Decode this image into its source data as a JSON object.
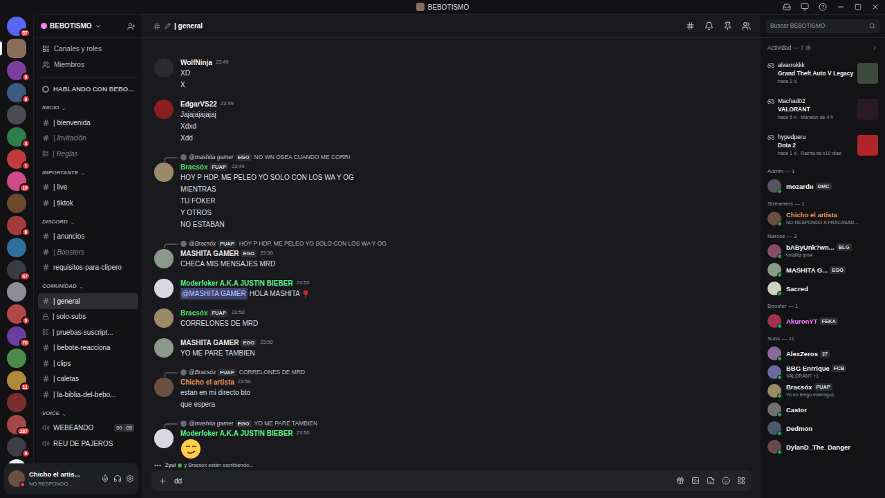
{
  "window": {
    "title": "BEBOTISMO"
  },
  "servers": [
    {
      "badge": "57",
      "color": "#5865f2",
      "selected": false
    },
    {
      "badge": "",
      "color": "#8a6d5a",
      "selected": true
    },
    {
      "badge": "9",
      "color": "#7b3fa0",
      "selected": false
    },
    {
      "badge": "8",
      "color": "#3d5a80",
      "selected": false
    },
    {
      "badge": "",
      "color": "#4a4a55",
      "selected": false
    },
    {
      "badge": "3",
      "color": "#2f7d4a",
      "selected": false
    },
    {
      "badge": "1",
      "color": "#c23b3b",
      "selected": false
    },
    {
      "badge": "10",
      "color": "#d04a8a",
      "selected": false
    },
    {
      "badge": "",
      "color": "#6b4a2e",
      "selected": false
    },
    {
      "badge": "6",
      "color": "#a33a3a",
      "selected": false
    },
    {
      "badge": "",
      "color": "#2e6f9e",
      "selected": false
    },
    {
      "badge": "47",
      "color": "#3a3a44",
      "selected": false
    },
    {
      "badge": "",
      "color": "#8d8d99",
      "selected": false
    },
    {
      "badge": "9",
      "color": "#b04747",
      "selected": false
    },
    {
      "badge": "70",
      "color": "#6a3fa0",
      "selected": false
    },
    {
      "badge": "",
      "color": "#4b8a4b",
      "selected": false
    },
    {
      "badge": "11",
      "color": "#b08a3a",
      "selected": false
    },
    {
      "badge": "",
      "color": "#7a2e2e",
      "selected": false
    },
    {
      "badge": "287",
      "color": "#a34848",
      "selected": false
    },
    {
      "badge": "9",
      "color": "#3e3e48",
      "selected": false
    },
    {
      "badge": "",
      "color": "#f2f3f5",
      "selected": false
    }
  ],
  "guild": {
    "name": "BEBOTISMO"
  },
  "sidebar": {
    "top_items": [
      {
        "label": "Canales y roles",
        "kind": "channels"
      },
      {
        "label": "Miembros",
        "kind": "members"
      }
    ],
    "event": "HABLANDO CON BEBO...",
    "categories": [
      {
        "name": "INICIO",
        "channels": [
          {
            "name": "| bienvenida",
            "kind": "text",
            "selected": false,
            "muted": false
          },
          {
            "name": "| Invitación",
            "kind": "text",
            "selected": false,
            "muted": true
          },
          {
            "name": "| Reglas",
            "kind": "rules",
            "selected": false,
            "muted": true
          }
        ]
      },
      {
        "name": "IMPORTANTE",
        "channels": [
          {
            "name": "| live",
            "kind": "text",
            "selected": false,
            "muted": false
          },
          {
            "name": "| tiktok",
            "kind": "text",
            "selected": false,
            "muted": false
          }
        ]
      },
      {
        "name": "DISCORD",
        "channels": [
          {
            "name": "| anuncios",
            "kind": "text",
            "selected": false,
            "muted": false
          },
          {
            "name": "| Boosters",
            "kind": "text",
            "selected": false,
            "muted": true
          },
          {
            "name": "requisitos-para-clipero",
            "kind": "text",
            "selected": false,
            "muted": false
          }
        ]
      },
      {
        "name": "COMUNIDAD",
        "channels": [
          {
            "name": "| general",
            "kind": "text",
            "selected": true,
            "muted": false
          },
          {
            "name": "| solo-subs",
            "kind": "locked",
            "selected": false,
            "muted": false
          },
          {
            "name": "| pruebas-suscript...",
            "kind": "rules",
            "selected": false,
            "muted": false
          },
          {
            "name": "| bebote-reacciona",
            "kind": "text",
            "selected": false,
            "muted": false
          },
          {
            "name": "| clips",
            "kind": "text",
            "selected": false,
            "muted": false
          },
          {
            "name": "| caletas",
            "kind": "text",
            "selected": false,
            "muted": false
          },
          {
            "name": "| la-biblia-del-bebo...",
            "kind": "text",
            "selected": false,
            "muted": false
          }
        ]
      },
      {
        "name": "VOICE",
        "channels": [
          {
            "name": "WEBEANDO",
            "kind": "voice",
            "selected": false,
            "muted": false,
            "counts": [
              "00",
              "05"
            ]
          },
          {
            "name": "REU DE PAJEROS",
            "kind": "voice",
            "selected": false,
            "muted": false,
            "counts": []
          }
        ]
      }
    ]
  },
  "user_panel": {
    "name": "Chicho el artis...",
    "status": "NO RESPONDO..."
  },
  "chat": {
    "channel": "| general"
  },
  "messages": [
    {
      "author": "WolfNinja",
      "color": "#f2f3f5",
      "avatar": "#2b2b30",
      "tag": "",
      "time": "23:49",
      "kind": "text",
      "reply": null,
      "mention": "",
      "lines": [
        "XD",
        "X"
      ]
    },
    {
      "author": "EdgarVS22",
      "color": "#f2f3f5",
      "avatar": "#8a1f1f",
      "tag": "",
      "time": "23:49",
      "kind": "text",
      "reply": null,
      "mention": "",
      "lines": [
        "Jajajajajajaj",
        "Xdxd",
        "Xdd"
      ]
    },
    {
      "author": "Bracsóx",
      "color": "#5bd46a",
      "avatar": "#9a8a6a",
      "tag": "FUAP",
      "time": "23:49",
      "kind": "text",
      "reply": {
        "author": "@mashita gamer",
        "tag": "EGO",
        "text": "NO WN OSEA CUANDO ME CORRI"
      },
      "mention": "",
      "lines": [
        "HOY P HDP. ME PELEO YO SOLO CON LOS WA Y OG",
        "MIENTRAS",
        "TU FOKER",
        "Y OTROS",
        "NO ESTABAN"
      ]
    },
    {
      "author": "MASHITA GAMER",
      "color": "#e6e6e6",
      "avatar": "#8a9a8a",
      "tag": "EGO",
      "time": "23:50",
      "kind": "text",
      "reply": {
        "author": "@Bracsóx",
        "tag": "FUAP",
        "text": "HOY P HDP. ME PELEO YO SOLO CON LOS WA Y OG"
      },
      "mention": "",
      "lines": [
        "CHECA MIS MENSAJES MRD"
      ]
    },
    {
      "author": "Moderfoker A.K.A JUSTIN BIEBER",
      "color": "#57f287",
      "avatar": "#d8d8e0",
      "tag": "",
      "time": "23:50",
      "kind": "mention",
      "reply": null,
      "mention": "@MASHITA GAMER",
      "lines": [
        "HOLA MASHITA"
      ]
    },
    {
      "author": "Bracsóx",
      "color": "#5bd46a",
      "avatar": "#9a8a6a",
      "tag": "FUAP",
      "time": "23:50",
      "kind": "text",
      "reply": null,
      "mention": "",
      "lines": [
        "CORRELONES DE MRD"
      ]
    },
    {
      "author": "MASHITA GAMER",
      "color": "#e6e6e6",
      "avatar": "#8a9a8a",
      "tag": "EGO",
      "time": "23:50",
      "kind": "text",
      "reply": null,
      "mention": "",
      "lines": [
        "YO ME PARE TAMBIEN"
      ]
    },
    {
      "author": "Chicho el artista",
      "color": "#e8955a",
      "avatar": "#6a5040",
      "tag": "",
      "time": "23:50",
      "kind": "text",
      "reply": {
        "author": "@Bracsóx",
        "tag": "FUAP",
        "text": "CORRELONES DE MRD"
      },
      "mention": "",
      "lines": [
        "estan en mi directo bto",
        "que espera"
      ]
    },
    {
      "author": "Moderfoker A.K.A JUSTIN BIEBER",
      "color": "#57f287",
      "avatar": "#d8d8e0",
      "tag": "",
      "time": "23:50",
      "kind": "emoji",
      "reply": {
        "author": "@mashita gamer",
        "tag": "EGO",
        "text": "YO ME PARE TAMBIEN"
      },
      "mention": "",
      "lines": []
    }
  ],
  "typing": {
    "first": "Zyul",
    "rest": "y Bracsóx están escribiendo..."
  },
  "input": {
    "value": "dd"
  },
  "search": {
    "placeholder": "Buscar BEBOTISMO"
  },
  "members": {
    "activity_header": "Actividad — 7",
    "activities": [
      {
        "name": "alvarrokkk",
        "game": "Grand Theft Auto V Legacy",
        "detail": "hace 2 d",
        "color": "#3c4a3c"
      },
      {
        "name": "Machad02",
        "game": "VALORANT",
        "detail": "hace 5 h · Maratón de 4 h",
        "color": "#2a1a22"
      },
      {
        "name": "hypedperu",
        "game": "Dota 2",
        "detail": "hace 1 d · Racha de x10 días",
        "color": "#b0242a"
      }
    ],
    "groups": [
      {
        "name": "Admin — 1",
        "members": [
          {
            "name": "mozardн",
            "color": "#f2f3f5",
            "tag": "DMC",
            "status": "",
            "avatar": "#555560"
          }
        ]
      },
      {
        "name": "Streamers — 1",
        "members": [
          {
            "name": "Chicho el artista",
            "color": "#e8955a",
            "tag": "",
            "status": "NO RESPONDO A FRACASAD...",
            "avatar": "#6a5040"
          }
        ]
      },
      {
        "name": "Narcos — 3",
        "members": [
          {
            "name": "bAByUnk?wn...",
            "color": "#f2f3f5",
            "tag": "BLG",
            "status": "volalita amw",
            "avatar": "#8a4a6a"
          },
          {
            "name": "MASHITA G...",
            "color": "#f2f3f5",
            "tag": "EGO",
            "status": "",
            "avatar": "#8a9a8a"
          },
          {
            "name": "Sacred",
            "color": "#f2f3f5",
            "tag": "",
            "status": "",
            "avatar": "#d0d0c0"
          }
        ]
      },
      {
        "name": "Booster — 1",
        "members": [
          {
            "name": "AkuronYT",
            "color": "#f47fff",
            "tag": "FEKA",
            "status": "",
            "avatar": "#a03050"
          }
        ]
      },
      {
        "name": "Subs — 11",
        "members": [
          {
            "name": "AlexZeros",
            "color": "#f2f3f5",
            "tag": "27",
            "status": "",
            "avatar": "#8a6a9a"
          },
          {
            "name": "BBG Enrrique",
            "color": "#f2f3f5",
            "tag": "FCB",
            "status": "VALORANT +1",
            "avatar": "#6a6aa0"
          },
          {
            "name": "Bracsóx",
            "color": "#f2f3f5",
            "tag": "FUAP",
            "status": "Yo no tengo enemigos.",
            "avatar": "#9a8a6a"
          },
          {
            "name": "Castor",
            "color": "#f2f3f5",
            "tag": "",
            "status": "",
            "avatar": "#707070"
          },
          {
            "name": "Dedmon",
            "color": "#f2f3f5",
            "tag": "",
            "status": "",
            "avatar": "#4a5a6a"
          },
          {
            "name": "DylanD_The_Danger",
            "color": "#f2f3f5",
            "tag": "",
            "status": "",
            "avatar": "#6a4a4a"
          }
        ]
      }
    ]
  }
}
